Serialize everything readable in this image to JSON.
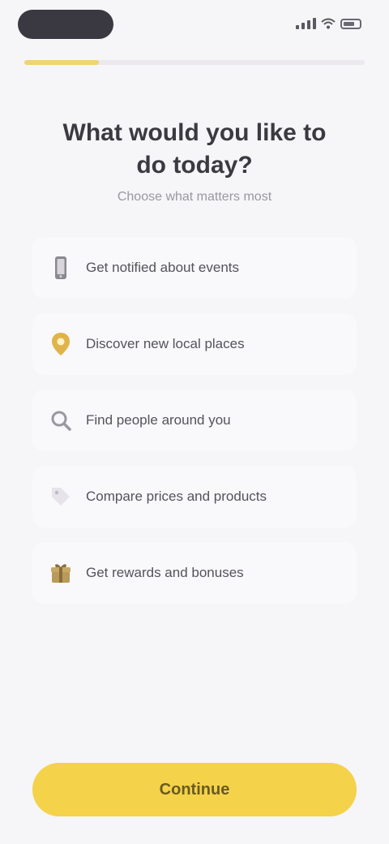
{
  "progress": {
    "fraction": 0.22
  },
  "header": {
    "title": "What would you like to do today?",
    "subtitle": "Choose what matters most"
  },
  "options": [
    {
      "label": "Get notified about events",
      "icon": "phone-icon"
    },
    {
      "label": "Discover new local places",
      "icon": "pin-icon"
    },
    {
      "label": "Find people around you",
      "icon": "search-icon"
    },
    {
      "label": "Compare prices and products",
      "icon": "tag-icon"
    },
    {
      "label": "Get rewards and bonuses",
      "icon": "gift-icon"
    }
  ],
  "cta": {
    "label": "Continue"
  },
  "colors": {
    "accent": "#f4d24a",
    "background": "#f6f5f8"
  }
}
